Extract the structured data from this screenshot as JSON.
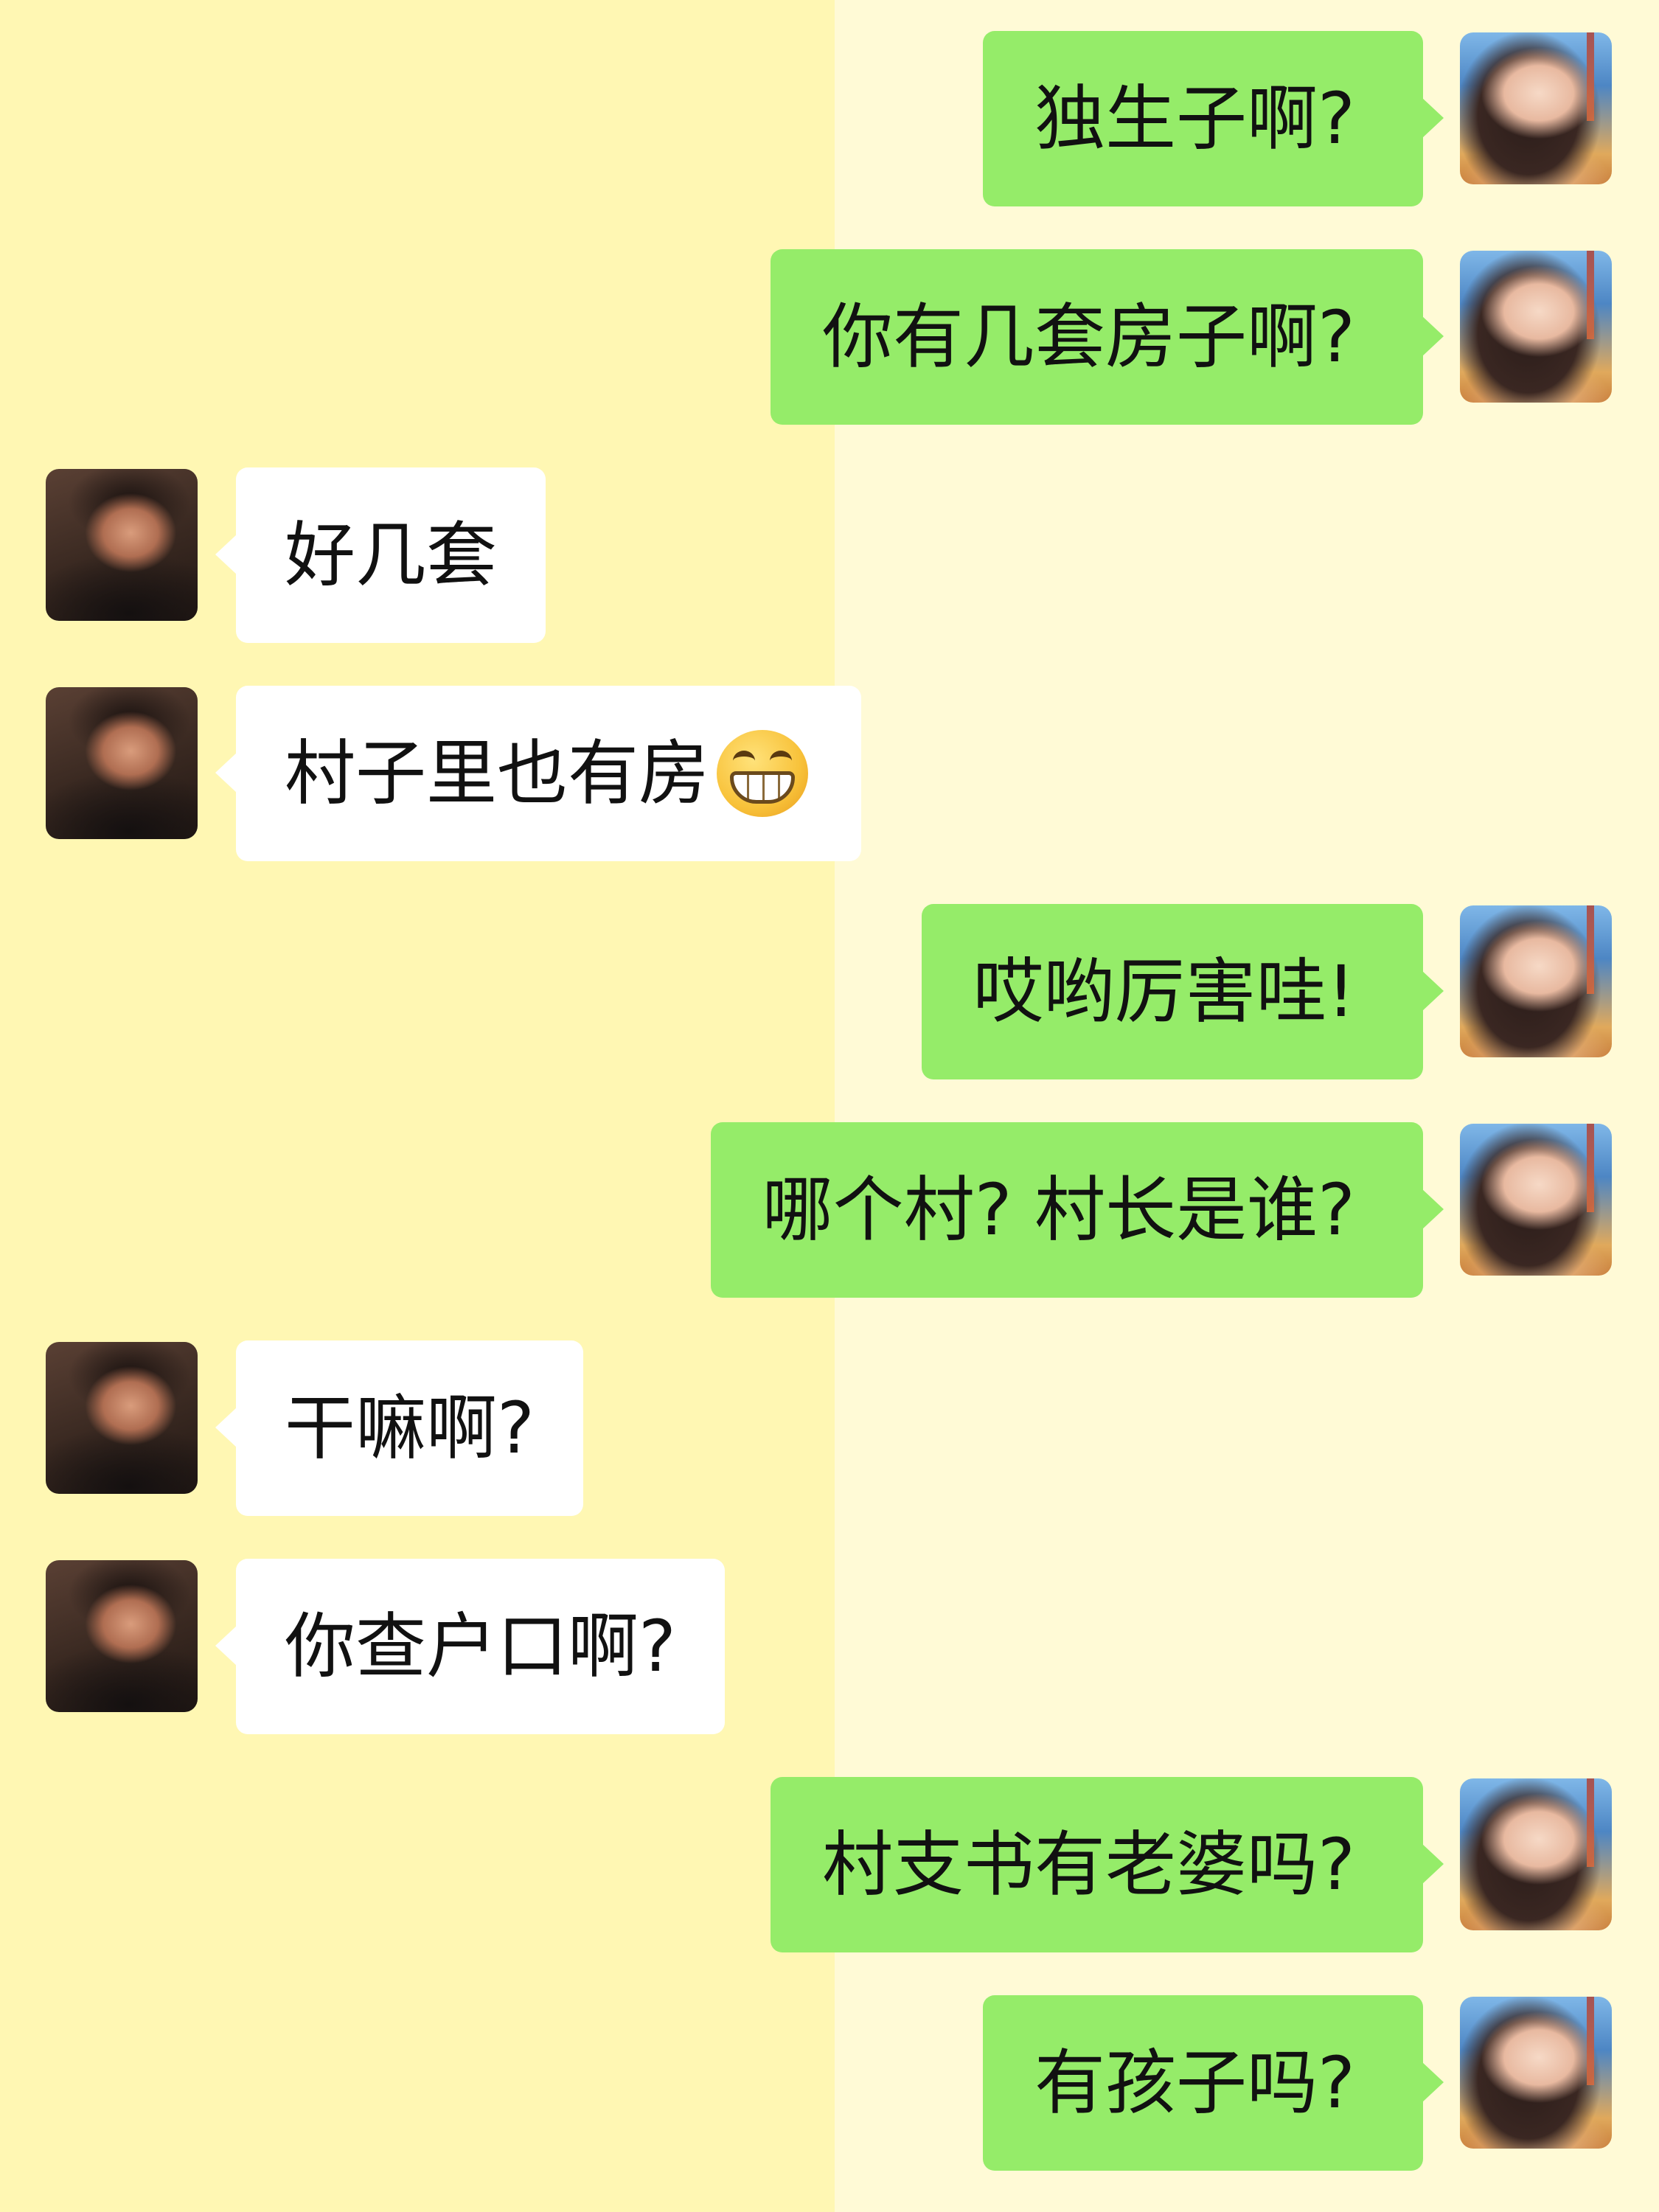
{
  "colors": {
    "left_background": "#FFF7B3",
    "right_background": "#FFFAD6",
    "outgoing_bubble": "#95EC69",
    "incoming_bubble": "#FFFFFF",
    "text": "#111111"
  },
  "messages": [
    {
      "sender": "me",
      "text": "独生子啊?"
    },
    {
      "sender": "me",
      "text": "你有几套房子啊?"
    },
    {
      "sender": "them",
      "text": "好几套"
    },
    {
      "sender": "them",
      "text": "村子里也有房",
      "emoji": "grinning-face-emoji"
    },
    {
      "sender": "me",
      "text": "哎哟厉害哇!"
    },
    {
      "sender": "me",
      "text": "哪个村? 村长是谁?"
    },
    {
      "sender": "them",
      "text": "干嘛啊?"
    },
    {
      "sender": "them",
      "text": "你查户口啊?"
    },
    {
      "sender": "me",
      "text": "村支书有老婆吗?"
    },
    {
      "sender": "me",
      "text": "有孩子吗?"
    }
  ]
}
